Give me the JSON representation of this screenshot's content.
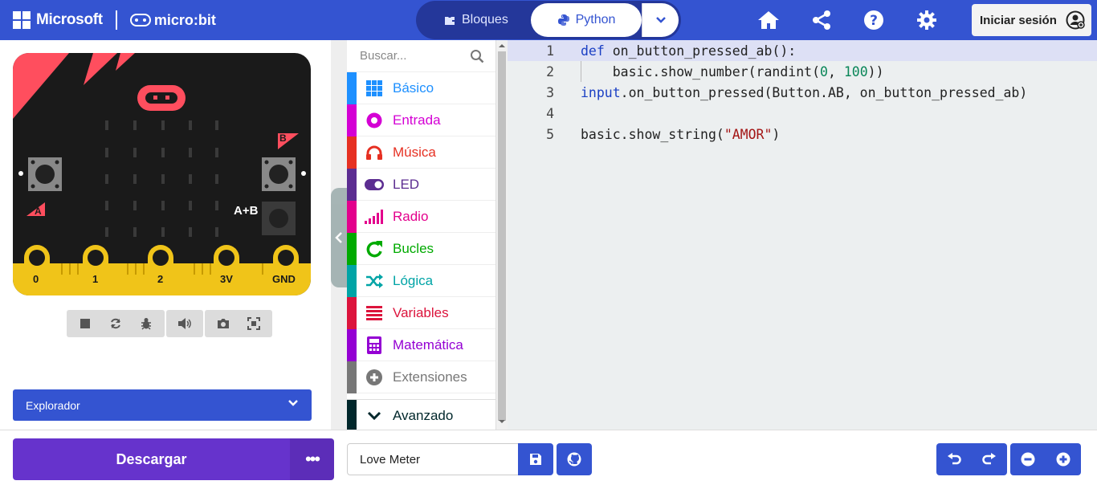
{
  "header": {
    "brand_microsoft": "Microsoft",
    "brand_microbit": "micro:bit",
    "tabs": [
      {
        "label": "Bloques",
        "active": false
      },
      {
        "label": "Python",
        "active": true
      }
    ],
    "signin_label": "Iniciar sesión",
    "icons": [
      "home-icon",
      "share-icon",
      "help-icon",
      "settings-icon"
    ]
  },
  "simulator": {
    "button_labels": {
      "a": "A",
      "b": "B",
      "ab": "A+B"
    },
    "pins": [
      "0",
      "1",
      "2",
      "3V",
      "GND"
    ],
    "controls": [
      "stop-icon",
      "restart-icon",
      "debug-icon",
      "sound-icon",
      "screenshot-icon",
      "fullscreen-icon"
    ]
  },
  "explorer": {
    "label": "Explorador"
  },
  "toolbox": {
    "search_placeholder": "Buscar...",
    "categories": [
      {
        "label": "Básico",
        "color": "#1e90ff"
      },
      {
        "label": "Entrada",
        "color": "#d400d4"
      },
      {
        "label": "Música",
        "color": "#e63022"
      },
      {
        "label": "LED",
        "color": "#5c2d91"
      },
      {
        "label": "Radio",
        "color": "#e3008c"
      },
      {
        "label": "Bucles",
        "color": "#00aa00"
      },
      {
        "label": "Lógica",
        "color": "#00a4a6"
      },
      {
        "label": "Variables",
        "color": "#dc143c"
      },
      {
        "label": "Matemática",
        "color": "#9400d3"
      },
      {
        "label": "Extensiones",
        "color": "#777777"
      },
      {
        "label": "Avanzado",
        "color": "#00272b"
      }
    ]
  },
  "editor": {
    "line_numbers": [
      "1",
      "2",
      "3",
      "4",
      "5"
    ],
    "active_line": 1,
    "code": {
      "l1_kw": "def",
      "l1_rest": " on_button_pressed_ab():",
      "l2_a": "    basic.show_number(randint(",
      "l2_n1": "0",
      "l2_b": ", ",
      "l2_n2": "100",
      "l2_c": "))",
      "l3_kw": "input",
      "l3_rest": ".on_button_pressed(Button.AB, on_button_pressed_ab)",
      "l5_a": "basic.show_string(",
      "l5_str": "\"AMOR\"",
      "l5_b": ")"
    }
  },
  "footer": {
    "download_label": "Descargar",
    "more_label": "•••",
    "project_name": "Love Meter",
    "icons": [
      "save-icon",
      "github-icon",
      "undo-icon",
      "redo-icon",
      "zoom-out-icon",
      "zoom-in-icon"
    ]
  },
  "colors": {
    "accent": "#3454d1",
    "download": "#6633cc"
  }
}
